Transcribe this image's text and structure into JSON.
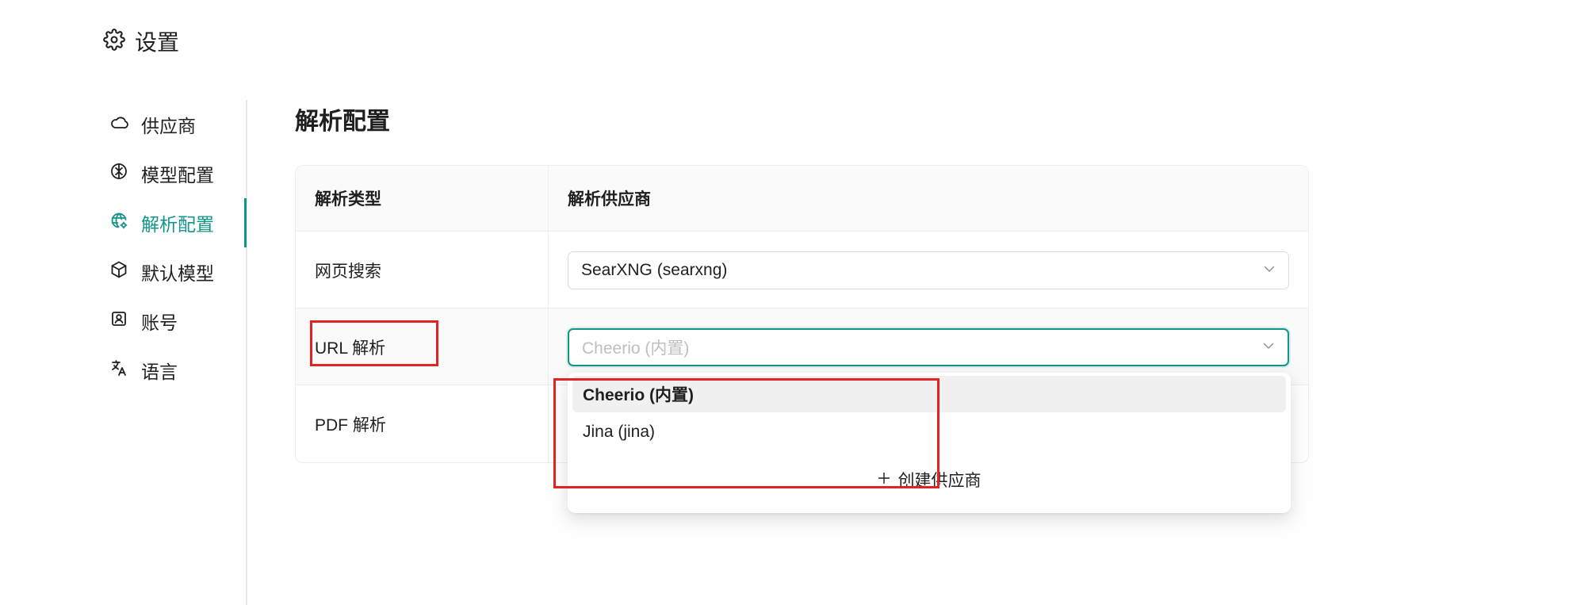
{
  "header": {
    "title": "设置",
    "icon": "gear-icon"
  },
  "sidebar": {
    "items": [
      {
        "label": "供应商",
        "icon": "cloud-icon"
      },
      {
        "label": "模型配置",
        "icon": "brain-icon"
      },
      {
        "label": "解析配置",
        "icon": "globe-gear-icon"
      },
      {
        "label": "默认模型",
        "icon": "cube-icon"
      },
      {
        "label": "账号",
        "icon": "account-icon"
      },
      {
        "label": "语言",
        "icon": "translate-icon"
      }
    ],
    "active_index": 2
  },
  "main": {
    "title": "解析配置",
    "table": {
      "headers": [
        "解析类型",
        "解析供应商"
      ],
      "rows": [
        {
          "type": "网页搜索",
          "provider": "SearXNG (searxng)"
        },
        {
          "type": "URL 解析",
          "provider_placeholder": "Cheerio (内置)"
        },
        {
          "type": "PDF 解析"
        }
      ]
    }
  },
  "dropdown": {
    "options": [
      "Cheerio (内置)",
      "Jina (jina)"
    ],
    "selected_index": 0,
    "create_label": "创建供应商",
    "create_icon": "plus-icon"
  },
  "colors": {
    "accent": "#12958a",
    "highlight_box": "#e02424"
  }
}
